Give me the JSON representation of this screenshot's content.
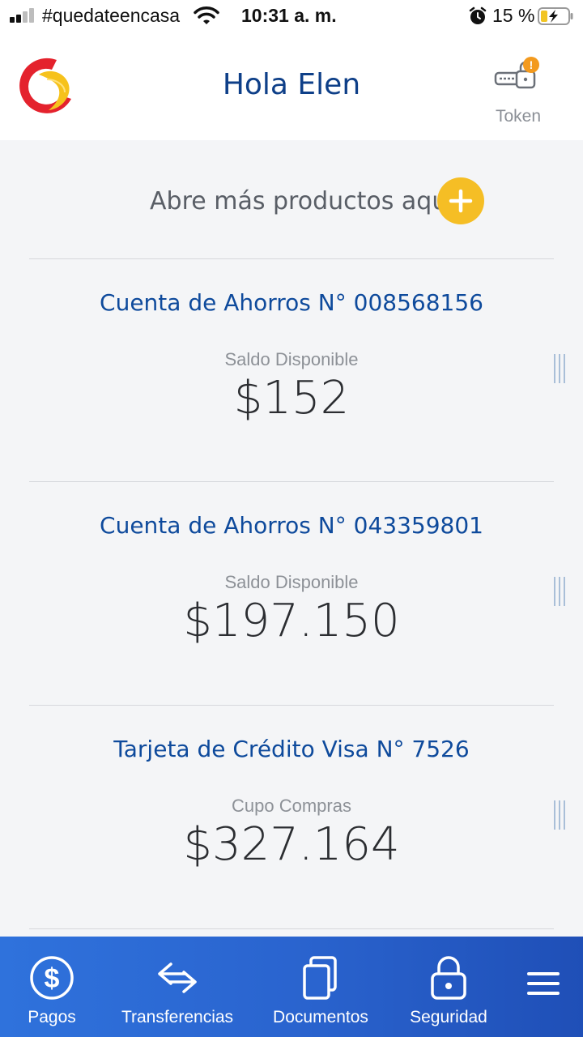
{
  "status_bar": {
    "carrier": "#quedateencasa",
    "time": "10:31 a. m.",
    "battery_percent": "15 %"
  },
  "header": {
    "greeting": "Hola Elen",
    "token_label": "Token",
    "token_badge": "!"
  },
  "open_more": {
    "label": "Abre más productos aquí"
  },
  "products": [
    {
      "title": "Cuenta de Ahorros N° 008568156",
      "caption": "Saldo Disponible",
      "amount": "$152"
    },
    {
      "title": "Cuenta de Ahorros N° 043359801",
      "caption": "Saldo Disponible",
      "amount": "$197.150"
    },
    {
      "title": "Tarjeta de Crédito Visa N° 7526",
      "caption": "Cupo Compras",
      "amount": "$327.164"
    }
  ],
  "bottom_nav": [
    {
      "label": "Pagos",
      "icon": "dollar-circle-icon"
    },
    {
      "label": "Transferencias",
      "icon": "transfer-arrows-icon"
    },
    {
      "label": "Documentos",
      "icon": "documents-icon"
    },
    {
      "label": "Seguridad",
      "icon": "padlock-icon"
    },
    {
      "label": "",
      "icon": "menu-icon"
    }
  ],
  "colors": {
    "brand_blue": "#0e3f88",
    "accent_yellow": "#f5be25",
    "nav_blue": "#2a64cf",
    "badge_orange": "#f39a1e"
  }
}
